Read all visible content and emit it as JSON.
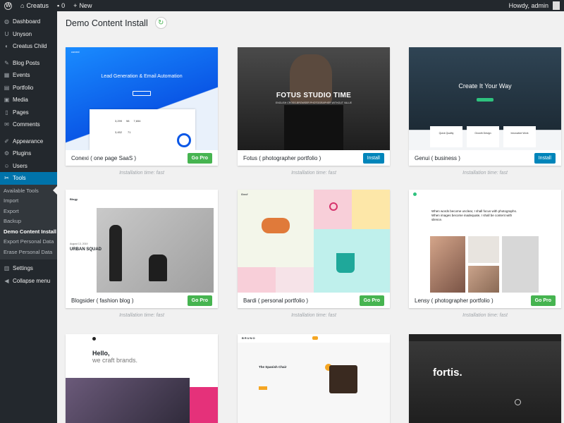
{
  "adminbar": {
    "site_name": "Creatus",
    "comments_count": "0",
    "new_label": "New",
    "greeting": "Howdy, admin"
  },
  "sidebar": {
    "items_top": [
      {
        "label": "Dashboard",
        "icon": "dashboard-icon",
        "glyph": "◍"
      },
      {
        "label": "Unyson",
        "icon": "unyson-icon",
        "glyph": "U"
      },
      {
        "label": "Creatus Child",
        "icon": "theme-icon",
        "glyph": "◐"
      }
    ],
    "items_mid": [
      {
        "label": "Blog Posts",
        "icon": "pin-icon",
        "glyph": "✎"
      },
      {
        "label": "Events",
        "icon": "events-icon",
        "glyph": "▦"
      },
      {
        "label": "Portfolio",
        "icon": "portfolio-icon",
        "glyph": "▤"
      },
      {
        "label": "Media",
        "icon": "media-icon",
        "glyph": "▣"
      },
      {
        "label": "Pages",
        "icon": "pages-icon",
        "glyph": "▯"
      },
      {
        "label": "Comments",
        "icon": "comments-icon",
        "glyph": "✉"
      }
    ],
    "items_low": [
      {
        "label": "Appearance",
        "icon": "brush-icon",
        "glyph": "✐"
      },
      {
        "label": "Plugins",
        "icon": "plugin-icon",
        "glyph": "⚙"
      },
      {
        "label": "Users",
        "icon": "users-icon",
        "glyph": "☺"
      },
      {
        "label": "Tools",
        "icon": "wrench-icon",
        "glyph": "✂"
      }
    ],
    "submenu": [
      "Available Tools",
      "Import",
      "Export",
      "Backup",
      "Demo Content Install",
      "Export Personal Data",
      "Erase Personal Data"
    ],
    "current_submenu": "Demo Content Install",
    "settings_label": "Settings",
    "collapse_label": "Collapse menu"
  },
  "page": {
    "title": "Demo Content Install",
    "refresh_icon": "refresh-icon"
  },
  "demos": [
    {
      "name": "Conexi ( one page SaaS )",
      "button": "Go Pro",
      "time": "Installation time: fast",
      "thumb": {
        "headline": "Lead Generation & Email Automation",
        "logo": "conexi",
        "stats": [
          "3,299",
          "98",
          "7,654",
          "3,452",
          "71"
        ]
      }
    },
    {
      "name": "Fotus ( photographer portfolio )",
      "button": "Install",
      "time": "Installation time: fast",
      "thumb": {
        "headline": "FOTUS STUDIO TIME",
        "sub": "ENGLISH CROSS-BROWSER PHOTOGRAPHER WITHOUT VALUE"
      }
    },
    {
      "name": "Genui ( business )",
      "button": "Install",
      "time": "Installation time: fast",
      "thumb": {
        "headline": "Create It Your Way",
        "cards": [
          "Quick Quality",
          "Growth Design",
          "Innovative Work"
        ]
      }
    },
    {
      "name": "Blogsider ( fashion blog )",
      "button": "Go Pro",
      "time": "Installation time: fast",
      "thumb": {
        "headline": "URBAN SQUAD",
        "date": "August 13, 2019",
        "logo": "Blogy"
      }
    },
    {
      "name": "Bardi ( personal portfolio )",
      "button": "Go Pro",
      "time": "Installation time: fast",
      "thumb": {
        "logo": "Bardi"
      }
    },
    {
      "name": "Lensy ( photographer portfolio )",
      "button": "Go Pro",
      "time": "Installation time: fast",
      "thumb": {
        "headline": "When words become unclear, I shall focus with photographs. When images become inadequate, I shall be content with silence."
      }
    },
    {
      "name": "",
      "button": "",
      "time": "",
      "thumb": {
        "headline": "Hello,",
        "sub": "we craft brands."
      }
    },
    {
      "name": "",
      "button": "",
      "time": "",
      "thumb": {
        "headline": "The Spanish Chair",
        "logo": "BRUNO"
      }
    },
    {
      "name": "",
      "button": "",
      "time": "",
      "thumb": {
        "headline": "fortis."
      }
    }
  ],
  "colors": {
    "accent": "#0073aa",
    "go_pro": "#46b450",
    "install": "#0085ba",
    "sidebar_bg": "#23282d"
  }
}
